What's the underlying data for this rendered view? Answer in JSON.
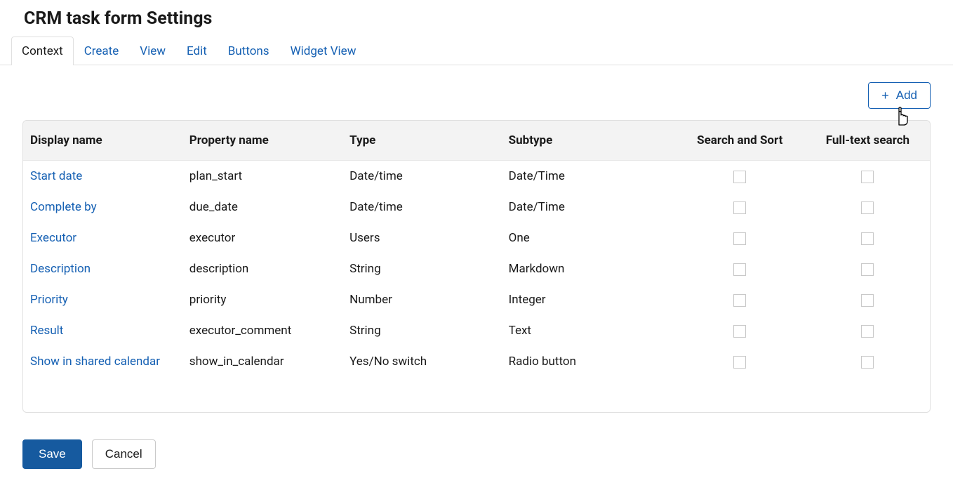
{
  "title": "CRM task form Settings",
  "tabs": [
    {
      "label": "Context",
      "active": true
    },
    {
      "label": "Create"
    },
    {
      "label": "View"
    },
    {
      "label": "Edit"
    },
    {
      "label": "Buttons"
    },
    {
      "label": "Widget View"
    }
  ],
  "toolbar": {
    "add_label": "Add",
    "plus": "+"
  },
  "columns": {
    "display": "Display name",
    "property": "Property name",
    "type": "Type",
    "subtype": "Subtype",
    "search_sort": "Search and Sort",
    "fulltext": "Full-text search"
  },
  "rows": [
    {
      "display": "Start date",
      "property": "plan_start",
      "type": "Date/time",
      "subtype": "Date/Time"
    },
    {
      "display": "Complete by",
      "property": "due_date",
      "type": "Date/time",
      "subtype": "Date/Time"
    },
    {
      "display": "Executor",
      "property": "executor",
      "type": "Users",
      "subtype": "One"
    },
    {
      "display": "Description",
      "property": "description",
      "type": "String",
      "subtype": "Markdown"
    },
    {
      "display": "Priority",
      "property": "priority",
      "type": "Number",
      "subtype": "Integer"
    },
    {
      "display": "Result",
      "property": "executor_comment",
      "type": "String",
      "subtype": "Text"
    },
    {
      "display": "Show in shared calendar",
      "property": "show_in_calendar",
      "type": "Yes/No switch",
      "subtype": "Radio button"
    }
  ],
  "footer": {
    "save": "Save",
    "cancel": "Cancel"
  }
}
